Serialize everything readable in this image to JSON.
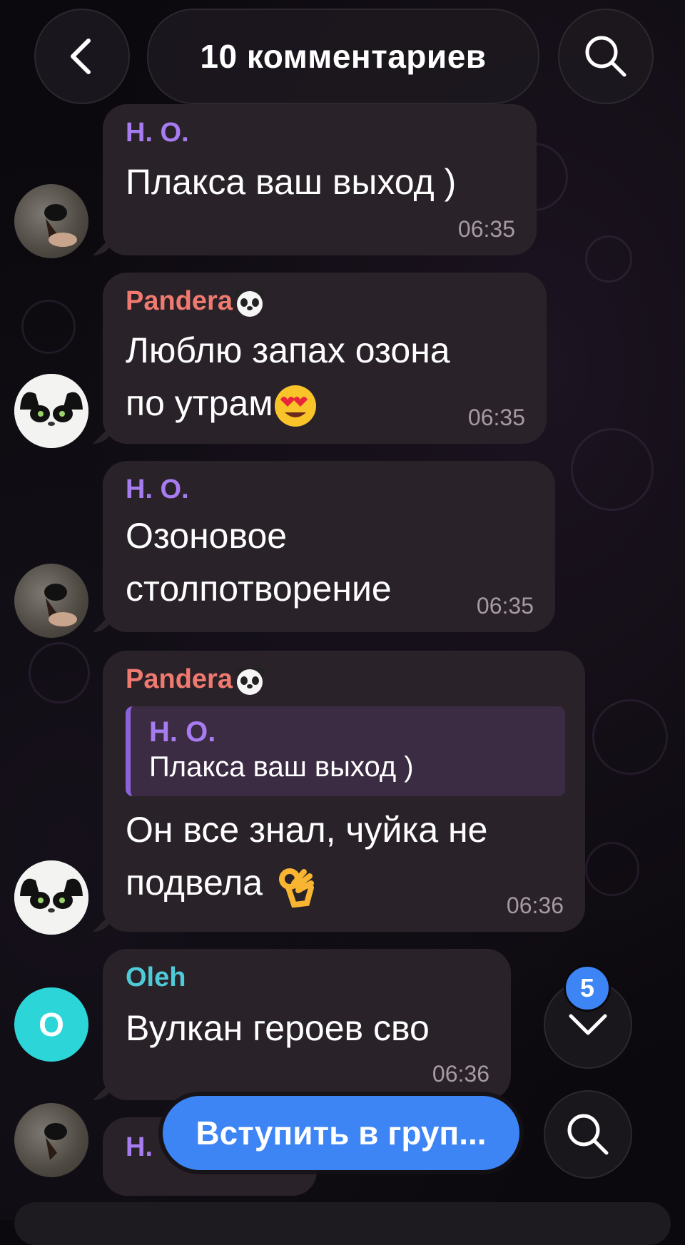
{
  "header": {
    "title": "10 комментариев",
    "back_icon": "chevron-left-icon",
    "search_icon": "search-icon"
  },
  "messages": [
    {
      "author": "Н. О.",
      "author_color": "#a77cf0",
      "text": "Плакса ваш выход )",
      "time": "06:35",
      "avatar": "photo"
    },
    {
      "author": "Pandera",
      "author_color": "#f07a6f",
      "author_emoji": "panda-face-icon",
      "text_line1": "Люблю запах озона",
      "text_line2": "по утрам",
      "text_emoji": "heart-eyes-emoji-icon",
      "time": "06:35",
      "avatar": "cat"
    },
    {
      "author": "Н. О.",
      "author_color": "#a77cf0",
      "text_line1": "Озоновое",
      "text_line2": "столпотворение",
      "time": "06:35",
      "avatar": "photo"
    },
    {
      "author": "Pandera",
      "author_color": "#f07a6f",
      "author_emoji": "panda-face-icon",
      "reply_author": "Н. О.",
      "reply_text": "Плакса ваш выход )",
      "text_line1": "Он все знал, чуйка не",
      "text_line2": "подвела",
      "text_emoji": "ok-hand-emoji-icon",
      "time": "06:36",
      "avatar": "cat"
    },
    {
      "author": "Oleh",
      "author_color": "#4fcbd8",
      "text": "Вулкан героев сво",
      "time": "06:36",
      "avatar": "letter",
      "avatar_letter": "O"
    }
  ],
  "partial": {
    "author": "Н."
  },
  "controls": {
    "unread_badge": "5",
    "join_button": "Вступить в груп...",
    "scroll_down_icon": "chevron-down-icon",
    "search_icon": "search-icon"
  },
  "colors": {
    "accent": "#3d84f5",
    "bubble": "#2a2229"
  }
}
